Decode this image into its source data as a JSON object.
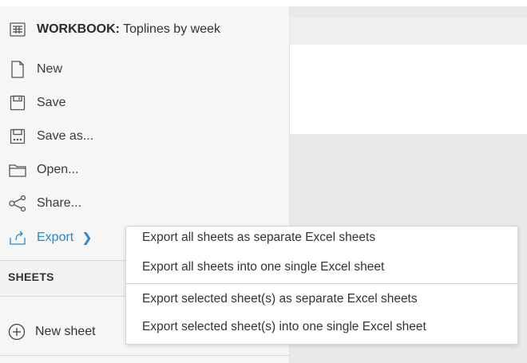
{
  "workbook": {
    "label": "WORKBOOK:",
    "name": "Toplines by week"
  },
  "menu": {
    "new": "New",
    "save": "Save",
    "save_as": "Save as...",
    "open": "Open...",
    "share": "Share...",
    "export": "Export"
  },
  "sheets": {
    "header": "SHEETS",
    "new_sheet": "New sheet"
  },
  "export_submenu": [
    "Export all sheets as separate Excel sheets",
    "Export all sheets into one single Excel sheet",
    "Export selected sheet(s) as separate Excel sheets",
    "Export selected sheet(s) into one single Excel sheet"
  ],
  "colors": {
    "accent": "#2a88c8",
    "panel_bg": "#f6f6f6"
  }
}
